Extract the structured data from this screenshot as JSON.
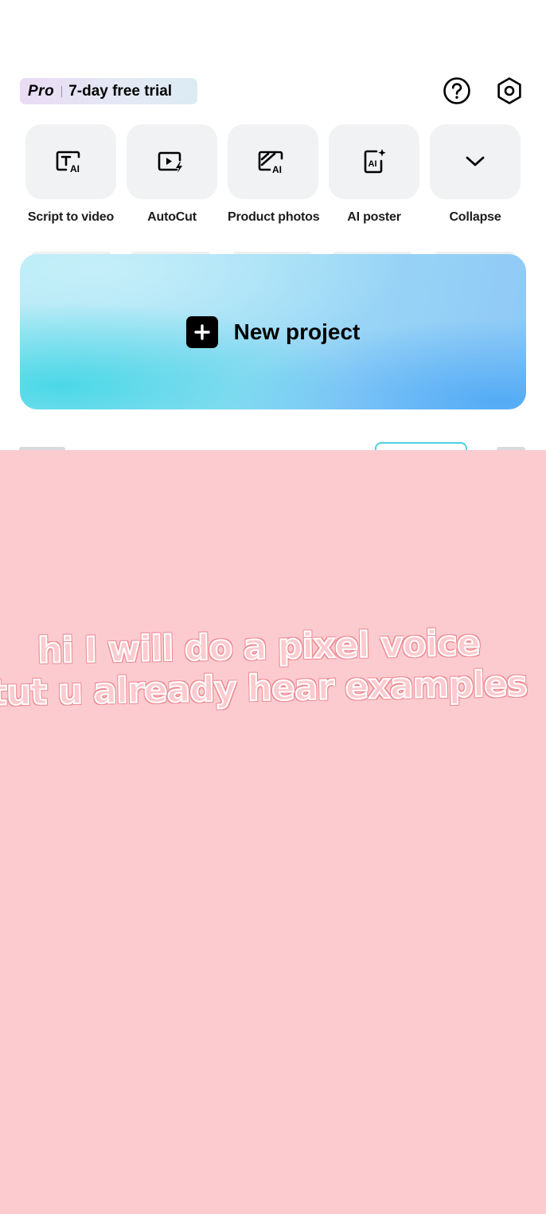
{
  "header": {
    "pro_label": "Pro",
    "trial_label": "7-day free trial",
    "help_icon": "help-icon",
    "settings_icon": "settings-icon"
  },
  "tools": [
    {
      "label": "Script to video",
      "icon": "script-ai-icon"
    },
    {
      "label": "AutoCut",
      "icon": "autocut-icon"
    },
    {
      "label": "Product photos",
      "icon": "product-photo-ai-icon"
    },
    {
      "label": "AI poster",
      "icon": "ai-poster-icon"
    },
    {
      "label": "Collapse",
      "icon": "chevron-down-icon"
    }
  ],
  "new_project": {
    "label": "New project",
    "icon": "plus-icon"
  },
  "overlay": {
    "color": "#fccbcf",
    "caption_line1": "hi I will do a pixel voice",
    "caption_line2": "tut u already hear examples"
  }
}
